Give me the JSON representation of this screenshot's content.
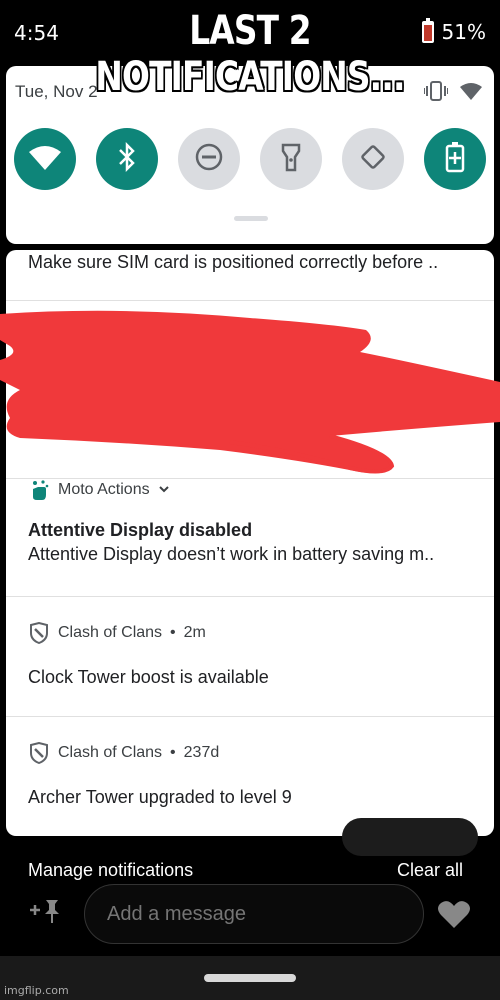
{
  "status_bar": {
    "time": "4:54",
    "battery": "51%"
  },
  "meme": {
    "caption_line1": "LAST 2",
    "caption_line2": "NOTIFICATIONS..."
  },
  "quick_settings": {
    "date": "Tue, Nov 2",
    "tiles": [
      {
        "icon": "wifi-icon",
        "state": "on"
      },
      {
        "icon": "bluetooth-icon",
        "state": "on"
      },
      {
        "icon": "do-not-disturb-icon",
        "state": "off"
      },
      {
        "icon": "flashlight-icon",
        "state": "off"
      },
      {
        "icon": "auto-rotate-icon",
        "state": "off"
      },
      {
        "icon": "battery-saver-icon",
        "state": "on"
      }
    ],
    "accent_color": "#0e8579"
  },
  "notifications": [
    {
      "text": "Make sure SIM card is positioned correctly before .."
    },
    {
      "redacted": true,
      "scribble_color": "#f0393b"
    },
    {
      "app": "Moto Actions",
      "expand_icon": "chevron-down-icon",
      "title": "Attentive Display disabled",
      "text": "Attentive Display doesn’t work in battery saving m.."
    },
    {
      "app": "Clash of Clans",
      "time": "2m",
      "text": "Clock Tower boost is available"
    },
    {
      "app": "Clash of Clans",
      "time": "237d",
      "text": "Archer Tower upgraded to level 9"
    }
  ],
  "footer": {
    "manage_label": "Manage notifications",
    "clear_label": "Clear all",
    "message_placeholder": "Add a message",
    "watermark": "imgflip.com"
  }
}
